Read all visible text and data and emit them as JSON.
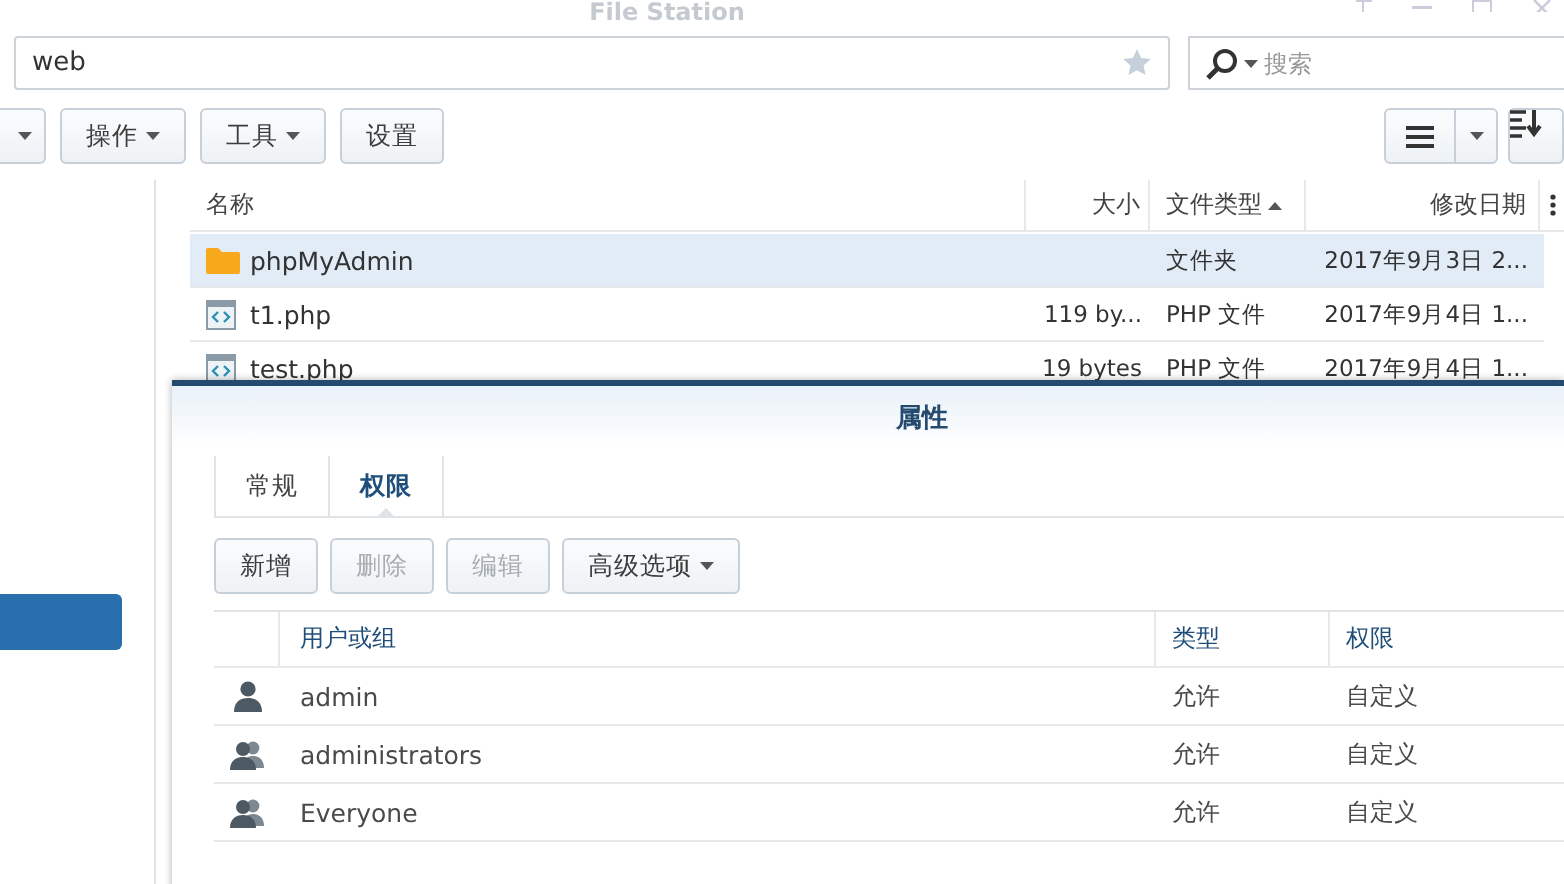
{
  "window": {
    "title": "File Station"
  },
  "path_field": {
    "value": "web"
  },
  "search": {
    "placeholder": "搜索"
  },
  "toolbar": {
    "buttons": [
      {
        "label": "操作",
        "kind": "dropdown"
      },
      {
        "label": "工具",
        "kind": "dropdown"
      },
      {
        "label": "设置",
        "kind": "plain"
      }
    ]
  },
  "file_list": {
    "columns": [
      {
        "label": "名称",
        "sorted": false
      },
      {
        "label": "大小",
        "sorted": false
      },
      {
        "label": "文件类型",
        "sorted": true
      },
      {
        "label": "修改日期",
        "sorted": false
      }
    ],
    "rows": [
      {
        "kind": "folder",
        "name": "phpMyAdmin",
        "type": "文件夹",
        "modified": "2017年9月3日 2...",
        "selected": true
      },
      {
        "kind": "file",
        "name": "t1.php",
        "size": "119 by...",
        "type": "PHP 文件",
        "modified": "2017年9月4日 1...",
        "selected": false
      },
      {
        "kind": "file",
        "name": "test.php",
        "size": "19 bytes",
        "type": "PHP 文件",
        "modified": "2017年9月4日 1...",
        "selected": false
      }
    ]
  },
  "dialog": {
    "title": "属性",
    "tabs": [
      {
        "label": "常规",
        "selected": false
      },
      {
        "label": "权限",
        "selected": true
      }
    ],
    "buttons": [
      {
        "label": "新增",
        "kind": "plain",
        "disabled": false
      },
      {
        "label": "删除",
        "kind": "plain",
        "disabled": true
      },
      {
        "label": "编辑",
        "kind": "plain",
        "disabled": true
      },
      {
        "label": "高级选项",
        "kind": "dropdown",
        "disabled": false
      }
    ],
    "table": {
      "columns": [
        "用户或组",
        "类型",
        "权限"
      ],
      "rows": [
        {
          "kind": "user",
          "name": "admin",
          "type": "允许",
          "permission": "自定义"
        },
        {
          "kind": "group",
          "name": "administrators",
          "type": "允许",
          "permission": "自定义"
        },
        {
          "kind": "group",
          "name": "Everyone",
          "type": "允许",
          "permission": "自定义"
        }
      ]
    }
  }
}
